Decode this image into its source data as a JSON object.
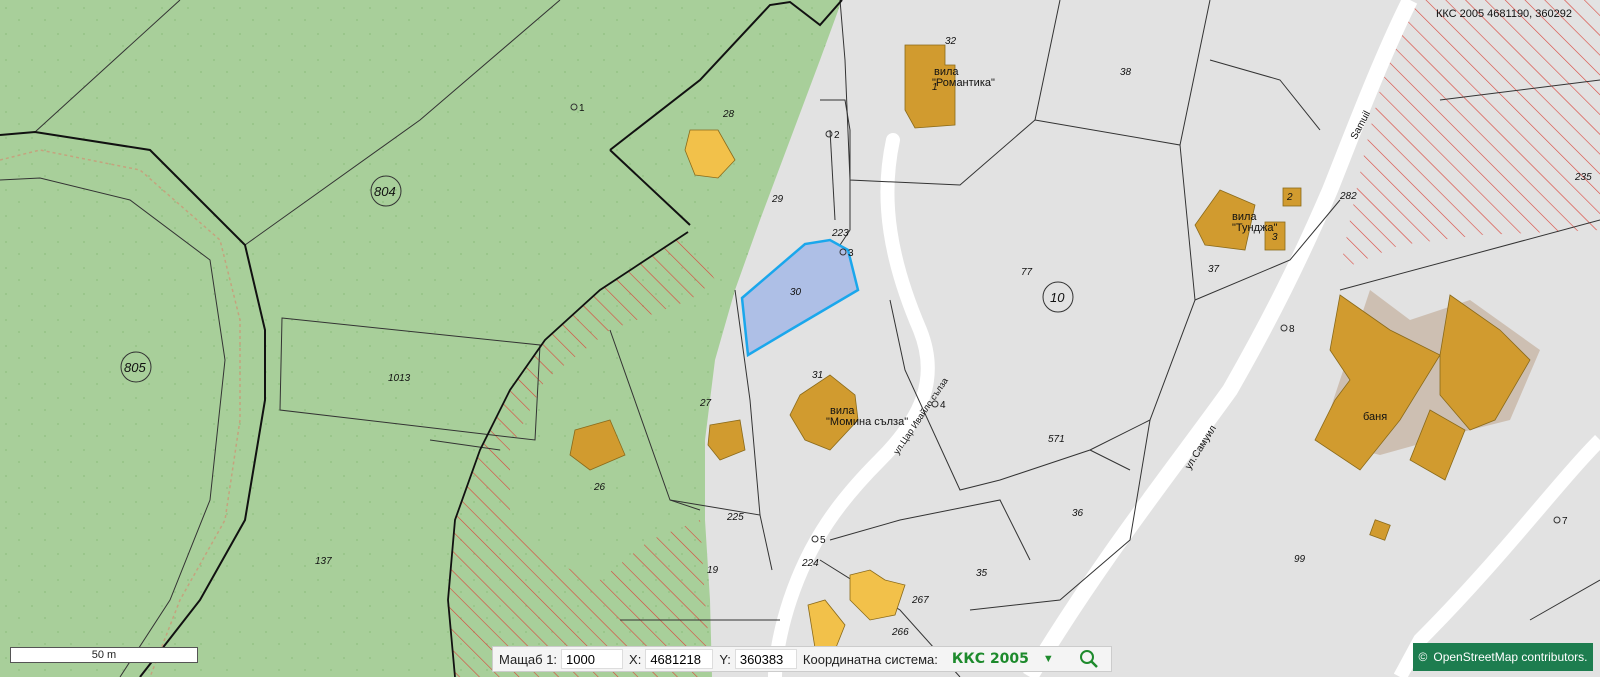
{
  "map": {
    "top_coordinate_readout": "ККС 2005 4681190, 360292",
    "parcel_numbers": [
      "32",
      "38",
      "28",
      "29",
      "223",
      "30",
      "31",
      "27",
      "26",
      "225",
      "224",
      "19",
      "267",
      "266",
      "77",
      "10",
      "571",
      "36",
      "35",
      "99",
      "37",
      "2",
      "3",
      "1",
      "282",
      "235",
      "804",
      "805",
      "1013",
      "137"
    ],
    "feature_labels": {
      "villa_romantika": [
        "вила",
        "\"Романтика\""
      ],
      "villa_tundzha": [
        "вила",
        "\"Тунджа\""
      ],
      "villa_momina_salza": [
        "вила",
        "\"Момина сълза\""
      ],
      "banya": "баня",
      "street_samuil_latin": "Samuil",
      "street_samuil_cyr": "ул.Самуил",
      "street_tsarevo": "ул.Цар Ивайло сълза",
      "points": [
        "1",
        "2",
        "3",
        "4",
        "5",
        "7",
        "8"
      ]
    },
    "colors": {
      "forest": "#a8cf9a",
      "urban": "#e2e2e2",
      "building": "#d19b2f",
      "highlight_fill": "#aebfe6",
      "highlight_stroke": "#1aa7ec",
      "hatch": "#d9433a"
    }
  },
  "scalebar": {
    "label": "50 m"
  },
  "toolbar": {
    "scale_label": "Мащаб 1:",
    "scale_value": "1000",
    "x_label": "X:",
    "x_value": "4681218",
    "y_label": "Y:",
    "y_value": "360383",
    "crs_label": "Координатна система:",
    "crs_value": "ККС 2005",
    "dropdown_icon": "chevron-down-icon",
    "search_icon": "search-icon"
  },
  "attribution": {
    "symbol": "©",
    "text": "OpenStreetMap contributors."
  }
}
